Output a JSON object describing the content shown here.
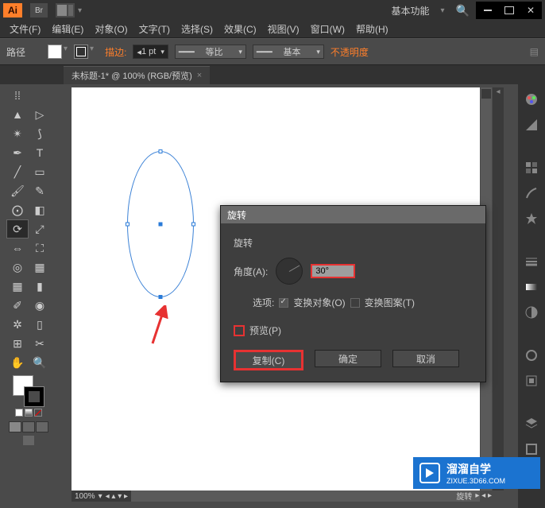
{
  "app": {
    "logo": "Ai",
    "badge": "Br",
    "workspace": "基本功能"
  },
  "menu": {
    "file": "文件(F)",
    "edit": "编辑(E)",
    "object": "对象(O)",
    "type": "文字(T)",
    "select": "选择(S)",
    "effect": "效果(C)",
    "view": "视图(V)",
    "window": "窗口(W)",
    "help": "帮助(H)"
  },
  "control": {
    "selection": "路径",
    "stroke_label": "描边:",
    "stroke_weight": "1 pt",
    "uniform": "等比",
    "style": "基本",
    "opacity": "不透明度"
  },
  "document": {
    "tab": "未标题-1* @ 100% (RGB/预览)"
  },
  "dialog": {
    "title": "旋转",
    "section": "旋转",
    "angle_label": "角度(A):",
    "angle_value": "30°",
    "options_label": "选项:",
    "transform_objects": "变换对象(O)",
    "transform_patterns": "变换图案(T)",
    "preview": "预览(P)",
    "copy": "复制(C)",
    "ok": "确定",
    "cancel": "取消"
  },
  "status": {
    "zoom": "100%",
    "rotate": "旋转"
  },
  "watermark": {
    "title": "溜溜自学",
    "url": "ZIXUE.3D66.COM"
  }
}
